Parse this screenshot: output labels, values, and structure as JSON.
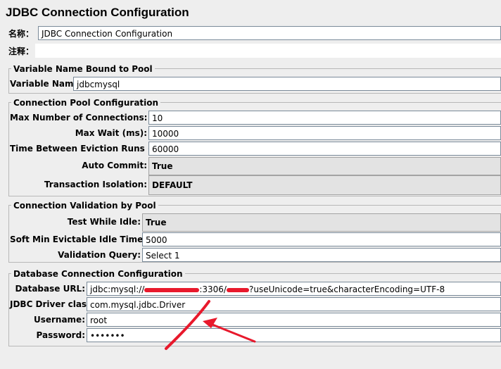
{
  "title": "JDBC Connection Configuration",
  "name": {
    "label": "名称：",
    "value": "JDBC Connection Configuration"
  },
  "comment": {
    "label": "注释：",
    "value": ""
  },
  "variable_section": {
    "legend": "Variable Name Bound to Pool",
    "variable_name": {
      "label": "Variable Name:",
      "value": "jdbcmysql"
    }
  },
  "pool_section": {
    "legend": "Connection Pool Configuration",
    "max_connections": {
      "label": "Max Number of Connections:",
      "value": "10"
    },
    "max_wait": {
      "label": "Max Wait (ms):",
      "value": "10000"
    },
    "eviction": {
      "label": "Time Between Eviction Runs (ms):",
      "value": "60000"
    },
    "auto_commit": {
      "label": "Auto Commit:",
      "value": "True"
    },
    "isolation": {
      "label": "Transaction Isolation:",
      "value": "DEFAULT"
    }
  },
  "validation_section": {
    "legend": "Connection Validation by Pool",
    "test_while_idle": {
      "label": "Test While Idle:",
      "value": "True"
    },
    "soft_min": {
      "label": "Soft Min Evictable Idle Time(ms):",
      "value": "5000"
    },
    "validation_query": {
      "label": "Validation Query:",
      "value": "Select 1"
    }
  },
  "db_section": {
    "legend": "Database Connection Configuration",
    "url": {
      "label": "Database URL:",
      "prefix": "jdbc:mysql://",
      "port": ":3306/",
      "suffix": "?useUnicode=true&characterEncoding=UTF-8"
    },
    "driver": {
      "label": "JDBC Driver class:",
      "value": "com.mysql.jdbc.Driver"
    },
    "username": {
      "label": "Username:",
      "value": "root"
    },
    "password": {
      "label": "Password:",
      "value": "•••••••"
    }
  },
  "colors": {
    "annotation": "#e8192c",
    "background": "#eeeeee"
  }
}
